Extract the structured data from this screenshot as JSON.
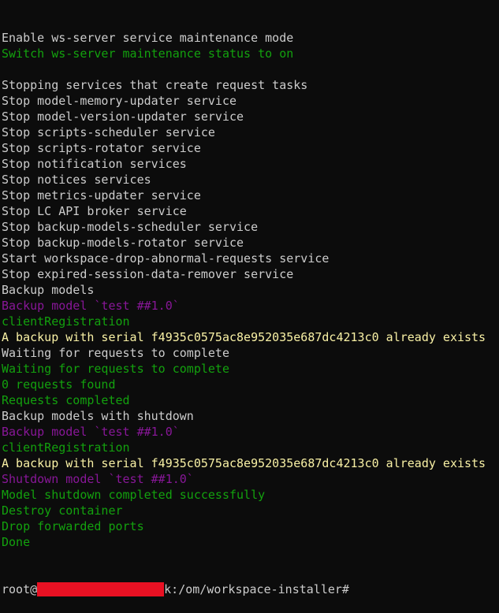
{
  "colors": {
    "background": "#0c0c0c",
    "default": "#cccccc",
    "green": "#13a10e",
    "purple": "#881798",
    "yellow": "#f9f1a5",
    "redaction": "#e81123"
  },
  "lines": [
    {
      "text": "Enable ws-server service maintenance mode",
      "color": "default"
    },
    {
      "text": "Switch ws-server maintenance status to on",
      "color": "green"
    },
    {
      "text": "",
      "color": "default"
    },
    {
      "text": "Stopping services that create request tasks",
      "color": "default"
    },
    {
      "text": "Stop model-memory-updater service",
      "color": "default"
    },
    {
      "text": "Stop model-version-updater service",
      "color": "default"
    },
    {
      "text": "Stop scripts-scheduler service",
      "color": "default"
    },
    {
      "text": "Stop scripts-rotator service",
      "color": "default"
    },
    {
      "text": "Stop notification services",
      "color": "default"
    },
    {
      "text": "Stop notices services",
      "color": "default"
    },
    {
      "text": "Stop metrics-updater service",
      "color": "default"
    },
    {
      "text": "Stop LC API broker service",
      "color": "default"
    },
    {
      "text": "Stop backup-models-scheduler service",
      "color": "default"
    },
    {
      "text": "Stop backup-models-rotator service",
      "color": "default"
    },
    {
      "text": "Start workspace-drop-abnormal-requests service",
      "color": "default"
    },
    {
      "text": "Stop expired-session-data-remover service",
      "color": "default"
    },
    {
      "text": "Backup models",
      "color": "default"
    },
    {
      "text": "Backup model `test ##1.0`",
      "color": "purple"
    },
    {
      "text": "clientRegistration",
      "color": "green"
    },
    {
      "text": "A backup with serial f4935c0575ac8e952035e687dc4213c0 already exists",
      "color": "yellow"
    },
    {
      "text": "Waiting for requests to complete",
      "color": "default"
    },
    {
      "text": "Waiting for requests to complete",
      "color": "green"
    },
    {
      "text": "0 requests found",
      "color": "green"
    },
    {
      "text": "Requests completed",
      "color": "green"
    },
    {
      "text": "Backup models with shutdown",
      "color": "default"
    },
    {
      "text": "Backup model `test ##1.0`",
      "color": "purple"
    },
    {
      "text": "clientRegistration",
      "color": "green"
    },
    {
      "text": "A backup with serial f4935c0575ac8e952035e687dc4213c0 already exists",
      "color": "yellow"
    },
    {
      "text": "Shutdown model `test ##1.0`",
      "color": "purple"
    },
    {
      "text": "Model shutdown completed successfully",
      "color": "green"
    },
    {
      "text": "Destroy container",
      "color": "green"
    },
    {
      "text": "Drop forwarded ports",
      "color": "green"
    },
    {
      "text": "Done",
      "color": "green"
    }
  ],
  "prompt": {
    "prefix": "root@",
    "suffix": "k:/om/workspace-installer#"
  }
}
